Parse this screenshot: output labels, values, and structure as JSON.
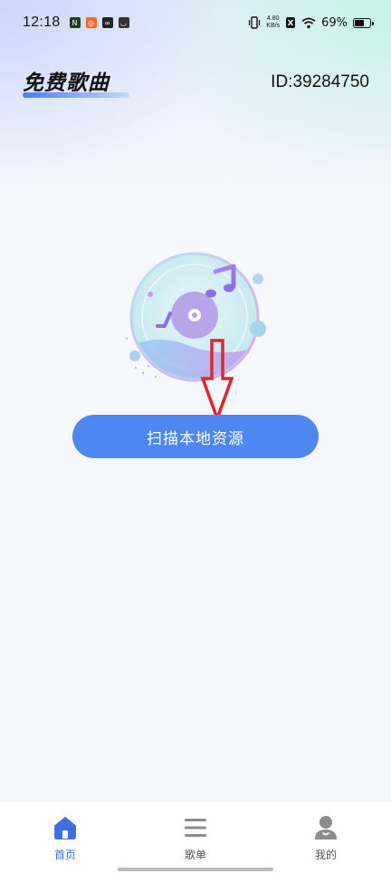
{
  "status_bar": {
    "time": "12:18",
    "speed_value": "4.80",
    "speed_unit": "KB/s",
    "battery": "69%",
    "battery_level": 0.69
  },
  "header": {
    "title": "免费歌曲",
    "user_id": "ID:39284750"
  },
  "main": {
    "scan_button_label": "扫描本地资源"
  },
  "bottom_nav": {
    "items": [
      {
        "label": "首页",
        "icon": "home-icon",
        "active": true
      },
      {
        "label": "歌单",
        "icon": "list-icon",
        "active": false
      },
      {
        "label": "我的",
        "icon": "user-icon",
        "active": false
      }
    ]
  },
  "colors": {
    "accent": "#4d88f2",
    "active_nav": "#3f6fe0",
    "arrow": "#e0262b"
  }
}
